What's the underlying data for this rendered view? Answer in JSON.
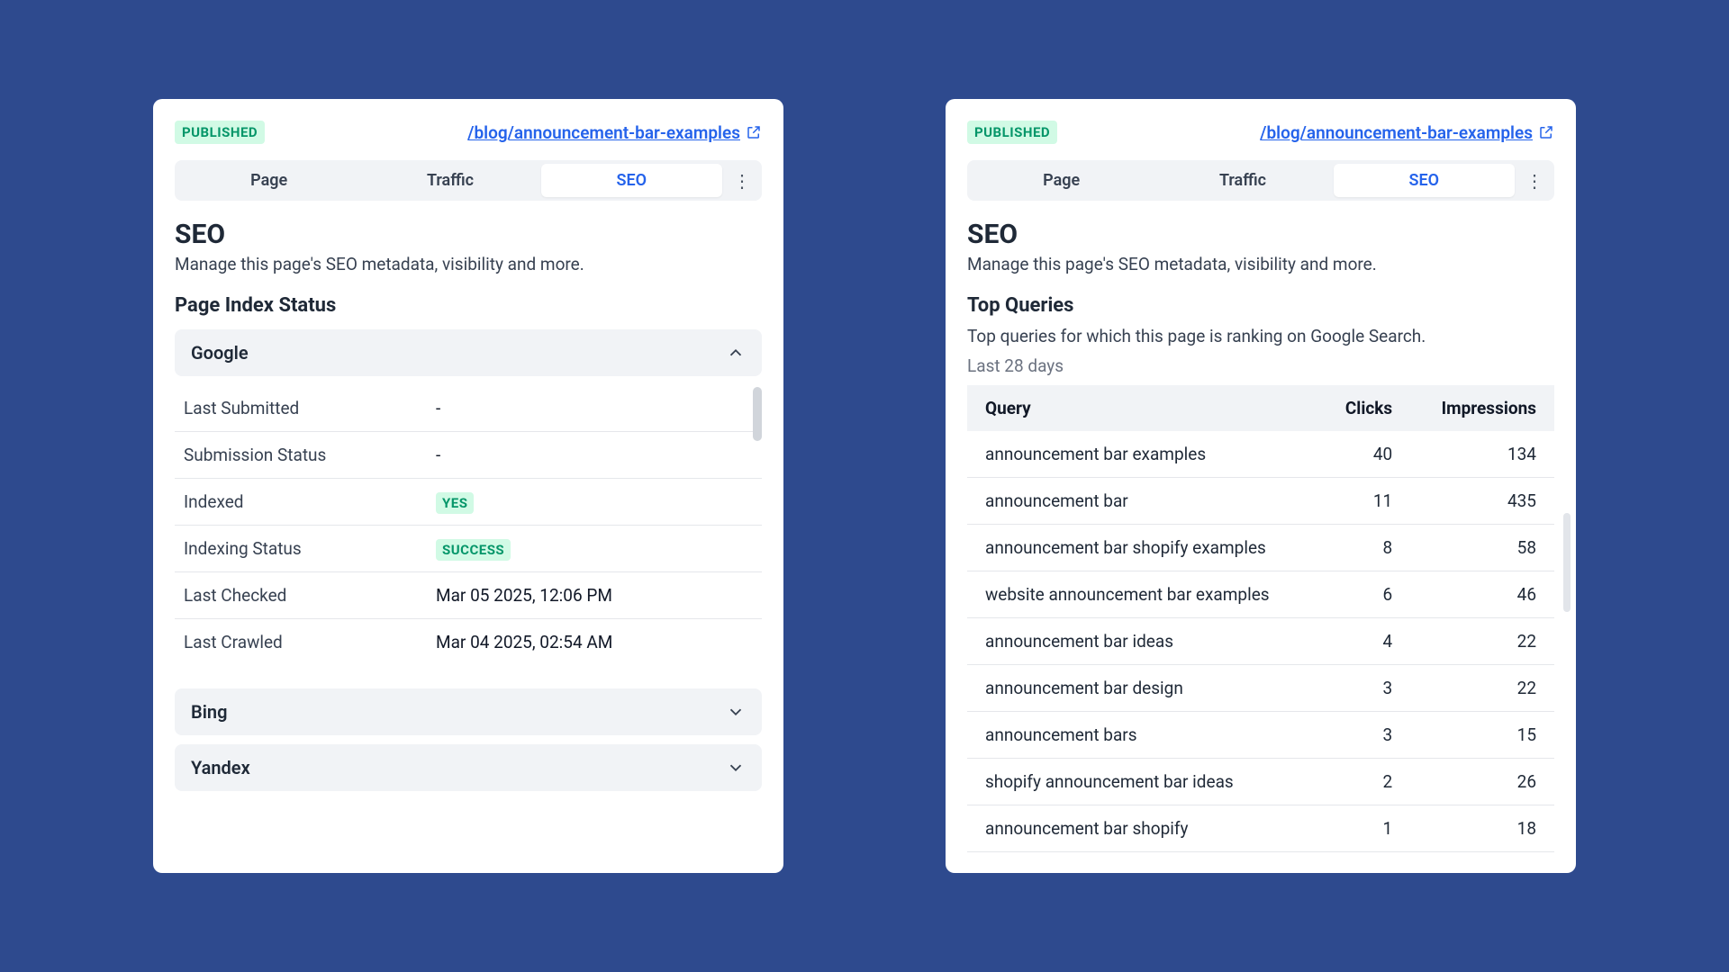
{
  "left": {
    "status_badge": "PUBLISHED",
    "url": "/blog/announcement-bar-examples",
    "tabs": {
      "page": "Page",
      "traffic": "Traffic",
      "seo": "SEO"
    },
    "title": "SEO",
    "subtitle": "Manage this page's SEO metadata, visibility and more.",
    "index_status_title": "Page Index Status",
    "engines": {
      "google": {
        "label": "Google",
        "rows": {
          "last_submitted": {
            "label": "Last Submitted",
            "value": "-"
          },
          "submission_status": {
            "label": "Submission Status",
            "value": "-"
          },
          "indexed": {
            "label": "Indexed",
            "value": "YES"
          },
          "indexing_status": {
            "label": "Indexing Status",
            "value": "SUCCESS"
          },
          "last_checked": {
            "label": "Last Checked",
            "value": "Mar 05 2025, 12:06 PM"
          },
          "last_crawled": {
            "label": "Last Crawled",
            "value": "Mar 04 2025, 02:54 AM"
          }
        }
      },
      "bing": {
        "label": "Bing"
      },
      "yandex": {
        "label": "Yandex"
      }
    }
  },
  "right": {
    "status_badge": "PUBLISHED",
    "url": "/blog/announcement-bar-examples",
    "tabs": {
      "page": "Page",
      "traffic": "Traffic",
      "seo": "SEO"
    },
    "title": "SEO",
    "subtitle": "Manage this page's SEO metadata, visibility and more.",
    "queries_title": "Top Queries",
    "queries_sub": "Top queries for which this page is ranking on Google Search.",
    "period": "Last 28 days",
    "table": {
      "headers": {
        "query": "Query",
        "clicks": "Clicks",
        "impressions": "Impressions"
      },
      "rows": [
        {
          "q": "announcement bar examples",
          "c": "40",
          "i": "134"
        },
        {
          "q": "announcement bar",
          "c": "11",
          "i": "435"
        },
        {
          "q": "announcement bar shopify examples",
          "c": "8",
          "i": "58"
        },
        {
          "q": "website announcement bar examples",
          "c": "6",
          "i": "46"
        },
        {
          "q": "announcement bar ideas",
          "c": "4",
          "i": "22"
        },
        {
          "q": "announcement bar design",
          "c": "3",
          "i": "22"
        },
        {
          "q": "announcement bars",
          "c": "3",
          "i": "15"
        },
        {
          "q": "shopify announcement bar ideas",
          "c": "2",
          "i": "26"
        },
        {
          "q": "announcement bar shopify",
          "c": "1",
          "i": "18"
        }
      ]
    }
  }
}
